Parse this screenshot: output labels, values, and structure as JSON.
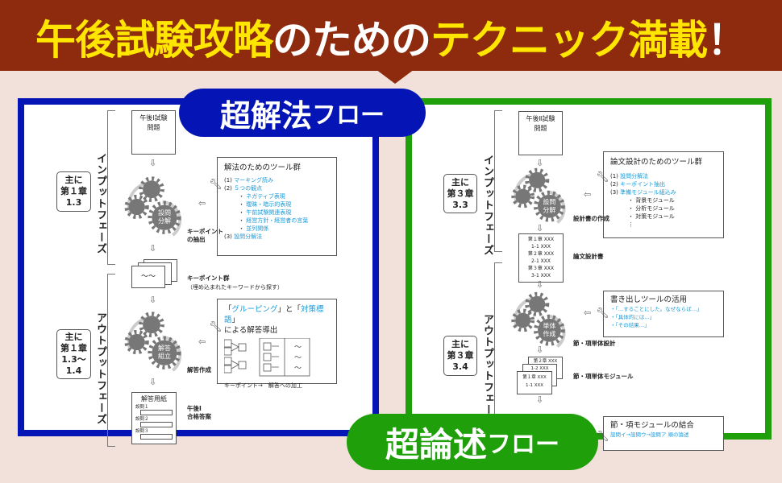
{
  "header": {
    "part1": "午後試験攻略",
    "part2": "のための",
    "part3": "テクニック満載",
    "part4": "！"
  },
  "colors": {
    "header_bg": "#8e2a0e",
    "headline_yellow": "#ffe600",
    "left_accent": "#0515b5",
    "right_accent": "#1fa00a",
    "link_blue": "#1a9ad8"
  },
  "left": {
    "pill_main": "超解法",
    "pill_sub": "フロー",
    "input": {
      "chapter": [
        "主に",
        "第１章",
        "1.3"
      ],
      "phase": "インプットフェーズ",
      "exam_box": [
        "午後Ⅰ試験",
        "問題"
      ],
      "gear_label": [
        "設問",
        "分解"
      ],
      "step_label": [
        "キーポイント",
        "の抽出"
      ],
      "tools": {
        "title": "解法のためのツール群",
        "items": [
          {
            "num": "(1)",
            "text": "マーキング読み"
          },
          {
            "num": "(2)",
            "text": "５つの観点"
          },
          {
            "num": "・",
            "text": "ネガティブ表現"
          },
          {
            "num": "・",
            "text": "曖昧・暗示的表現"
          },
          {
            "num": "・",
            "text": "午前試験関連表現"
          },
          {
            "num": "・",
            "text": "経営方針・経営者の言葉"
          },
          {
            "num": "・",
            "text": "並列関係"
          },
          {
            "num": "(3)",
            "text": "設問分解法"
          }
        ]
      },
      "result_label": "キーポイント群",
      "result_sub": "（埋め込まれたキーワードから探す）",
      "wave": "〜〜"
    },
    "output": {
      "chapter": [
        "主に",
        "第１章",
        "1.3〜",
        "1.4"
      ],
      "phase": "アウトプットフェーズ",
      "gear_label": [
        "解答",
        "組立"
      ],
      "step_label": "解答作成",
      "tools": {
        "q1": "「",
        "t1": "グルーピング",
        "q2": "」と「",
        "t2": "対策標語",
        "q3": "」",
        "line2": "による解答導出",
        "tilde": "〜",
        "caption": "キーポイント→　解答への加工"
      },
      "sheet": {
        "title": "解答用紙",
        "q": [
          "設問１",
          "設問２",
          "設問３"
        ]
      },
      "result_label": [
        "午後Ⅰ",
        "合格答案"
      ]
    }
  },
  "right": {
    "pill_main": "超論述",
    "pill_sub": "フロー",
    "input": {
      "chapter": [
        "主に",
        "第３章",
        "3.3"
      ],
      "phase": "インプットフェーズ",
      "exam_box": [
        "午後Ⅱ試験",
        "問題"
      ],
      "gear_label": [
        "設問",
        "分解"
      ],
      "step_label": "設計書の作成",
      "tools": {
        "title": "論文設計のためのツール群",
        "items": [
          {
            "num": "(1)",
            "text": "設問分解法",
            "blue": true
          },
          {
            "num": "(2)",
            "text": "キーポイント抽出",
            "blue": true
          },
          {
            "num": "(3)",
            "text": "準備モジュール組込み",
            "blue": true
          },
          {
            "num": "・",
            "text": "背景モジュール"
          },
          {
            "num": "・",
            "text": "分析モジュール"
          },
          {
            "num": "・",
            "text": "対策モジュール"
          },
          {
            "num": "",
            "text": "⋮"
          }
        ]
      },
      "doc": [
        "第１章 XXX",
        "1-1 XXX",
        "第２章 XXX",
        "2-1 XXX",
        "第３章 XXX",
        "3-1 XXX"
      ],
      "doc_label": "論文設計書"
    },
    "output": {
      "chapter": [
        "主に",
        "第３章",
        "3.4"
      ],
      "phase": "アウトプットフェーズ",
      "gear_label": [
        "単体",
        "作成"
      ],
      "step_label": "節・項単体設計",
      "tools": {
        "title": "書き出しツールの活用",
        "items": [
          "・「…することにした。なぜならば…」",
          "・「具体的には…」",
          "・「その結果…」"
        ]
      },
      "modules": {
        "back": "第２章 XXX",
        "mid": "1-2 XXX",
        "front": [
          "第１章 XXX",
          "1-1 XXX"
        ]
      },
      "module_label": "節・項単体モジュール",
      "combine": {
        "title": "節・項モジュールの結合",
        "text": "設問イ→設問ウ→設問ア 順の論述"
      }
    }
  }
}
